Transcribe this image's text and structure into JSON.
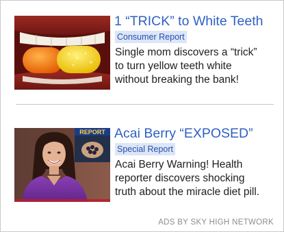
{
  "ads": [
    {
      "headline": "1 “TRICK” to White Teeth",
      "tag": "Consumer Report",
      "desc_lines": [
        "Single mom discovers a “trick”",
        "to turn yellow teeth white",
        "without breaking the bank!"
      ]
    },
    {
      "headline": "Acai Berry “EXPOSED”",
      "tag": "Special Report",
      "inset_label": "REPORT",
      "desc_lines": [
        "Acai Berry Warning!  Health",
        "reporter discovers shocking",
        "truth about the miracle diet pill."
      ]
    }
  ],
  "footer": {
    "credit": "ADS BY SKY HIGH NETWORK"
  },
  "colors": {
    "headline": "#2f60c4",
    "tag_bg": "#dbe6f7",
    "tag_text": "#2a4fae",
    "body_text": "#202020",
    "credit": "#8c8c8c"
  }
}
